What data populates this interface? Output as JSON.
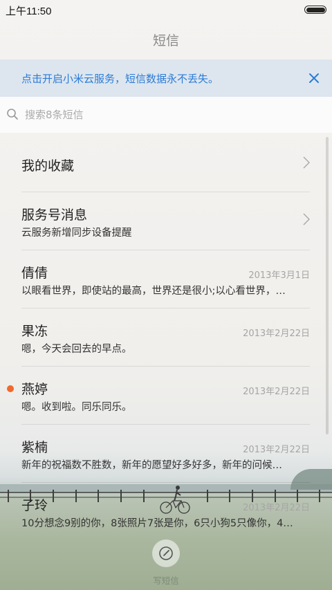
{
  "status_bar": {
    "time": "上午11:50"
  },
  "header": {
    "title": "短信"
  },
  "banner": {
    "text": "点击开启小米云服务，短信数据永不丢失。"
  },
  "search": {
    "placeholder": "搜索8条短信",
    "value": ""
  },
  "conversations": [
    {
      "name": "我的收藏",
      "snippet": "",
      "date": "",
      "chevron": true,
      "unread": false
    },
    {
      "name": "服务号消息",
      "snippet": "云服务新增同步设备提醒",
      "date": "",
      "chevron": true,
      "unread": false
    },
    {
      "name": "倩倩",
      "snippet": "以眼看世界，即使站的最高，世界还是很小;以心看世界，…",
      "date": "2013年3月1日",
      "chevron": false,
      "unread": false
    },
    {
      "name": "果冻",
      "snippet": "嗯，今天会回去的早点。",
      "date": "2013年2月22日",
      "chevron": false,
      "unread": false
    },
    {
      "name": "燕婷",
      "snippet": "嗯。收到啦。同乐同乐。",
      "date": "2013年2月22日",
      "chevron": false,
      "unread": true
    },
    {
      "name": "紫楠",
      "snippet": "新年的祝福数不胜数，新年的愿望好多好多，新年的问候…",
      "date": "2013年2月22日",
      "chevron": false,
      "unread": false
    },
    {
      "name": "子玲",
      "snippet": "10分想念9别的你，8张照片7张是你，6只小狗5只像你，4…",
      "date": "2013年2月22日",
      "chevron": false,
      "unread": false
    }
  ],
  "compose": {
    "label": "写短信"
  },
  "colors": {
    "accent": "#2b7bd6",
    "banner_bg": "#dde6ef",
    "unread": "#f06a2a"
  }
}
